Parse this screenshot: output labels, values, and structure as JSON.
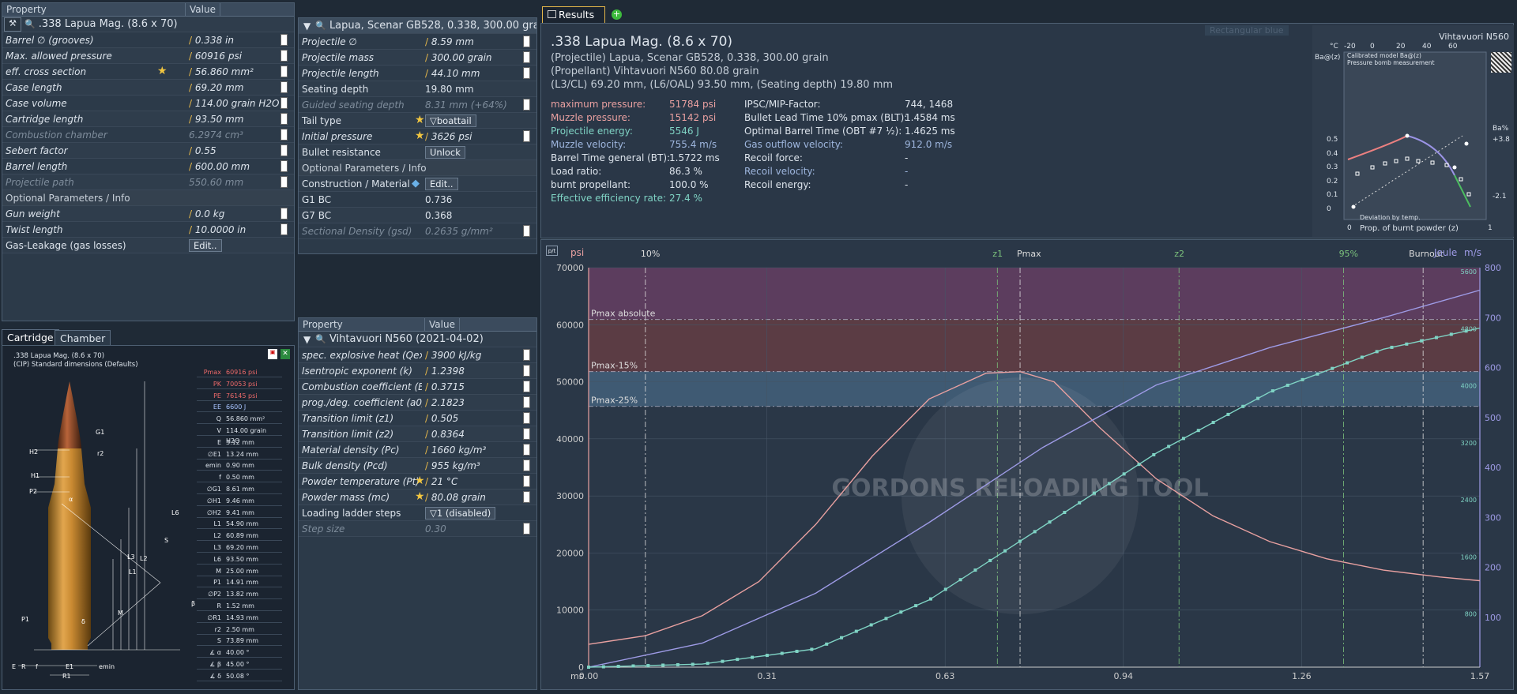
{
  "cartridge_panel": {
    "header": {
      "property": "Property",
      "value": "Value"
    },
    "title": ".338 Lapua Mag. (8.6 x 70)",
    "rows": [
      {
        "k": "Barrel ∅ (grooves)",
        "v": "0.338 in",
        "type": "edit"
      },
      {
        "k": "Max. allowed pressure",
        "v": "60916 psi",
        "type": "edit"
      },
      {
        "k": "eff. cross section",
        "v": "56.860 mm²",
        "type": "edit"
      },
      {
        "k": "Case length",
        "v": "69.20 mm",
        "type": "edit"
      },
      {
        "k": "Case volume",
        "v": "114.00 grain H2O",
        "type": "edit"
      },
      {
        "k": "Cartridge length",
        "v": "93.50 mm",
        "type": "edit"
      },
      {
        "k": "Combustion chamber",
        "v": "6.2974 cm³",
        "type": "dis"
      },
      {
        "k": "Sebert factor",
        "v": "0.55",
        "type": "edit"
      },
      {
        "k": "Barrel length",
        "v": "600.00 mm",
        "type": "edit"
      },
      {
        "k": "Projectile path",
        "v": "550.60 mm",
        "type": "dis"
      },
      {
        "k": "Optional Parameters / Info",
        "v": "",
        "type": "sec"
      },
      {
        "k": "Gun weight",
        "v": "0.0 kg",
        "type": "edit"
      },
      {
        "k": "Twist length",
        "v": "10.0000 in",
        "type": "edit"
      },
      {
        "k": "Gas-Leakage (gas losses)",
        "v": "Edit..",
        "type": "btn"
      }
    ]
  },
  "projectile_panel": {
    "title": "Lapua, Scenar GB528, 0.338, 300.00 grain",
    "rows": [
      {
        "k": "Projectile ∅",
        "v": "8.59 mm",
        "type": "edit"
      },
      {
        "k": "Projectile mass",
        "v": "300.00 grain",
        "type": "edit"
      },
      {
        "k": "Projectile length",
        "v": "44.10 mm",
        "type": "edit"
      },
      {
        "k": "Seating depth",
        "v": "19.80 mm",
        "type": "plain"
      },
      {
        "k": "Guided seating depth",
        "v": "8.31 mm (+64%)",
        "type": "dis"
      },
      {
        "k": "Tail type",
        "v": "boattail",
        "type": "drop"
      },
      {
        "k": "Initial pressure",
        "v": "3626 psi",
        "type": "edit"
      },
      {
        "k": "Bullet resistance",
        "v": "Unlock",
        "type": "btn"
      },
      {
        "k": "Optional Parameters / Info",
        "v": "",
        "type": "sec"
      },
      {
        "k": "Construction / Material",
        "v": "Edit..",
        "type": "btn"
      },
      {
        "k": "G1 BC",
        "v": "0.736",
        "type": "plain"
      },
      {
        "k": "G7 BC",
        "v": "0.368",
        "type": "plain"
      },
      {
        "k": "Sectional Density (gsd)",
        "v": "0.2635 g/mm²",
        "type": "dis"
      }
    ]
  },
  "powder_panel": {
    "header": {
      "property": "Property",
      "value": "Value"
    },
    "title": "Vihtavuori N560 (2021-04-02)",
    "rows": [
      {
        "k": "spec. explosive heat (Qex)",
        "v": "3900 kJ/kg",
        "type": "edit"
      },
      {
        "k": "Isentropic exponent (k)",
        "v": "1.2398",
        "type": "edit"
      },
      {
        "k": "Combustion coefficient (Ba)",
        "v": "0.3715",
        "type": "edit"
      },
      {
        "k": "prog./deg. coefficient (a0)",
        "v": "2.1823",
        "type": "edit"
      },
      {
        "k": "Transition limit (z1)",
        "v": "0.505",
        "type": "edit"
      },
      {
        "k": "Transition limit (z2)",
        "v": "0.8364",
        "type": "edit"
      },
      {
        "k": "Material density (Pc)",
        "v": "1660 kg/m³",
        "type": "edit"
      },
      {
        "k": "Bulk density (Pcd)",
        "v": "955 kg/m³",
        "type": "edit"
      },
      {
        "k": "Powder temperature (Pt)",
        "v": "21 °C",
        "type": "edit"
      },
      {
        "k": "Powder mass (mc)",
        "v": "80.08 grain",
        "type": "edit"
      },
      {
        "k": "Loading ladder steps",
        "v": "1 (disabled)",
        "type": "drop"
      },
      {
        "k": "Step size",
        "v": "0.30",
        "type": "dis"
      }
    ]
  },
  "drawing": {
    "tabs": [
      "Cartridge",
      "Chamber"
    ],
    "title": ".338 Lapua Mag. (8.6 x 70)",
    "subtitle": "(CIP) Standard dimensions (Defaults)",
    "table": [
      [
        "Pmax",
        "60916 psi"
      ],
      [
        "PK",
        "70053 psi"
      ],
      [
        "PE",
        "76145 psi"
      ],
      [
        "EE",
        "6600 J"
      ],
      [
        "Q",
        "56.860 mm²"
      ],
      [
        "V",
        "114.00 grain H2O"
      ],
      [
        "E",
        "3.12 mm"
      ],
      [
        "∅E1",
        "13.24 mm"
      ],
      [
        "emin",
        "0.90 mm"
      ],
      [
        "f",
        "0.50 mm"
      ],
      [
        "∅G1",
        "8.61 mm"
      ],
      [
        "∅H1",
        "9.46 mm"
      ],
      [
        "∅H2",
        "9.41 mm"
      ],
      [
        "L1",
        "54.90 mm"
      ],
      [
        "L2",
        "60.89 mm"
      ],
      [
        "L3",
        "69.20 mm"
      ],
      [
        "L6",
        "93.50 mm"
      ],
      [
        "M",
        "25.00 mm"
      ],
      [
        "P1",
        "14.91 mm"
      ],
      [
        "∅P2",
        "13.82 mm"
      ],
      [
        "R",
        "1.52 mm"
      ],
      [
        "∅R1",
        "14.93 mm"
      ],
      [
        "r2",
        "2.50 mm"
      ],
      [
        "S",
        "73.89 mm"
      ],
      [
        "∡ α",
        "40.00 °"
      ],
      [
        "∡ β",
        "45.00 °"
      ],
      [
        "∡ δ",
        "50.08 °"
      ]
    ],
    "dims": [
      "G1",
      "r2",
      "H2",
      "H1",
      "P2",
      "α",
      "L6",
      "S",
      "L3",
      "L2",
      "L1",
      "M",
      "β",
      "δ",
      "P1",
      "E",
      "R",
      "f",
      "E1",
      "R1",
      "emin"
    ]
  },
  "results": {
    "tab": "Results",
    "title": ".338 Lapua Mag. (8.6 x 70)",
    "lines": [
      "(Projectile) Lapua, Scenar GB528, 0.338, 300.00 grain",
      "(Propellant) Vihtavuori N560 80.08 grain",
      "(L3/CL) 69.20 mm, (L6/OAL) 93.50 mm, (Seating depth) 19.80 mm"
    ],
    "col1": [
      [
        "maximum pressure:",
        "51784 psi",
        "red"
      ],
      [
        "Muzzle pressure:",
        "15142 psi",
        "red"
      ],
      [
        "Projectile energy:",
        "5546 J",
        "teal"
      ],
      [
        "Muzzle velocity:",
        "755.4 m/s",
        "blue"
      ],
      [
        "Barrel Time general (BT):",
        "1.5722 ms",
        "w"
      ],
      [
        "Load ratio:",
        "86.3 %",
        "w"
      ],
      [
        "burnt propellant:",
        "100.0 %",
        "w"
      ],
      [
        "Effective efficiency rate:",
        "27.4 %",
        "teal"
      ]
    ],
    "col2": [
      [
        "IPSC/MIP-Factor:",
        "744, 1468",
        "w"
      ],
      [
        "Bullet Lead Time 10% pmax (BLT):",
        "1.4584 ms",
        "w"
      ],
      [
        "Optimal Barrel Time (OBT #7 ½):",
        "1.4625 ms",
        "w"
      ],
      [
        "Gas outflow velocity:",
        "912.0 m/s",
        "blue"
      ],
      [
        "Recoil force:",
        "-",
        "w"
      ],
      [
        "Recoil velocity:",
        "-",
        "blue"
      ],
      [
        "Recoil energy:",
        "-",
        "w"
      ]
    ],
    "faded": "Rectangular blue"
  },
  "mini_chart": {
    "title": "Vihtavuori N560",
    "xlabel": "Prop. of burnt powder (z)",
    "ylabel_left": "Ba@(z)",
    "ylabel_right": "Ba%",
    "unit": "°C",
    "top_ticks": [
      "-20",
      "0",
      "20",
      "40",
      "60"
    ],
    "left_ticks": [
      "0.5",
      "0.4",
      "0.3",
      "0.2",
      "0.1",
      "0"
    ],
    "right_ticks": [
      "+3.8",
      "-2.1"
    ],
    "bottom_ticks": [
      "0",
      "1"
    ],
    "legend": [
      "Calibrated model Ba@(z)",
      "Pressure bomb measurement",
      "Deviation by temp."
    ]
  },
  "chart_data": {
    "type": "line",
    "x_label": "ms",
    "y_left_unit": "psi",
    "y_right_units": [
      "Joule",
      "m/s"
    ],
    "x_ticks": [
      "0.00",
      "0.31",
      "0.63",
      "0.94",
      "1.26",
      "1.57"
    ],
    "y_ticks": [
      "0",
      "10000",
      "20000",
      "30000",
      "40000",
      "50000",
      "60000",
      "70000"
    ],
    "y_right_joule": [
      "800",
      "1600",
      "2400",
      "3200",
      "4000",
      "4800",
      "5600"
    ],
    "y_right_ms": [
      "100",
      "200",
      "300",
      "400",
      "500",
      "600",
      "700",
      "800"
    ],
    "xlim": [
      0,
      1.57
    ],
    "ylim": [
      0,
      70000
    ],
    "markers": [
      "10%",
      "z1",
      "Pmax",
      "z2",
      "95%",
      "Burnout"
    ],
    "bands": [
      "Pmax absolute",
      "Pmax-15%",
      "Pmax-25%"
    ],
    "series": [
      {
        "name": "pressure",
        "color": "#e8a0a0",
        "x": [
          0,
          0.1,
          0.2,
          0.3,
          0.4,
          0.5,
          0.6,
          0.7,
          0.76,
          0.82,
          0.9,
          1.0,
          1.1,
          1.2,
          1.3,
          1.4,
          1.5,
          1.57
        ],
        "y": [
          4000,
          5500,
          9000,
          15000,
          25000,
          37000,
          47000,
          51500,
          51784,
          50000,
          42000,
          33000,
          26500,
          22000,
          19000,
          17000,
          15800,
          15142
        ]
      },
      {
        "name": "velocity",
        "color": "#9e9be6",
        "x": [
          0,
          0.2,
          0.4,
          0.6,
          0.8,
          1.0,
          1.2,
          1.4,
          1.57
        ],
        "y": [
          0,
          48,
          148,
          290,
          440,
          565,
          640,
          700,
          755
        ]
      },
      {
        "name": "energy",
        "color": "#7fd3c4",
        "x": [
          0,
          0.2,
          0.4,
          0.6,
          0.8,
          1.0,
          1.2,
          1.4,
          1.57
        ],
        "y": [
          0,
          50,
          300,
          1100,
          2300,
          3500,
          4500,
          5200,
          5546
        ]
      }
    ]
  },
  "watermark": "GORDONS RELOADING TOOL"
}
